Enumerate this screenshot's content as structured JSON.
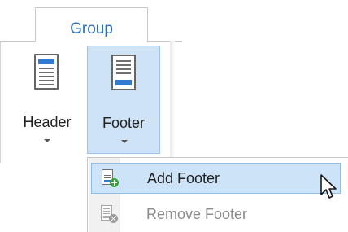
{
  "ribbon": {
    "group_tab_label": "Group",
    "buttons": [
      {
        "label": "Header",
        "icon": "header-document-icon"
      },
      {
        "label": "Footer",
        "icon": "footer-document-icon",
        "state": "pressed"
      }
    ]
  },
  "dropdown": {
    "items": [
      {
        "label": "Add Footer",
        "icon": "add-footer-icon",
        "state": "hover"
      },
      {
        "label": "Remove Footer",
        "icon": "remove-footer-icon",
        "state": "disabled"
      }
    ]
  },
  "colors": {
    "accent": "#2b6fb6",
    "selection_fill": "#cde4f8",
    "selection_border": "#8fbfe9",
    "doc_band": "#2f7bd1"
  }
}
